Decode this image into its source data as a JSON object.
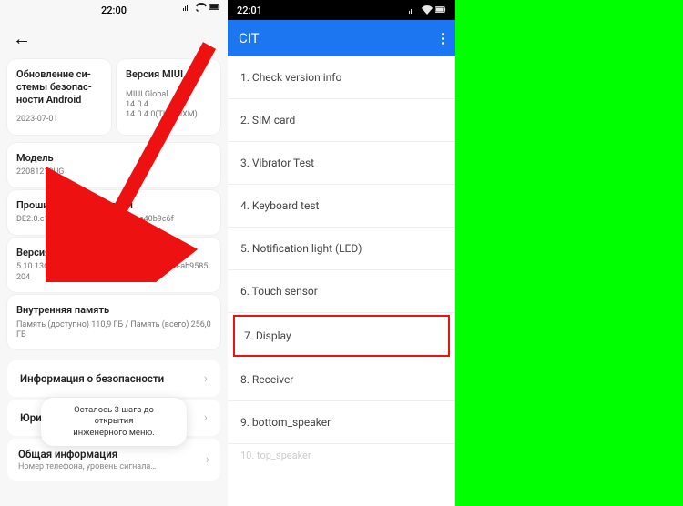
{
  "left": {
    "status_time": "22:00",
    "card1_title": "Обновление си-\nстемы безопас-\nности Android",
    "card1_sub": "2023-07-01",
    "card2_title": "Версия MIUI",
    "card2_sub": "MIUI Global\n14.0.4\n14.0.4.0(TLFRUXM)",
    "model_title": "Модель",
    "model_sub": "22081212UG",
    "firmware_title": "Прошивка модуля связи",
    "firmware_sub": "DE2.0.c1-gl-19921.1…6_0554_b5ce40b9c6f",
    "kernel_title": "Версия ядра",
    "kernel_sub": "5.10.136-android12-9-00021-g821df8f5bd36-ab9585204",
    "storage_title": "Внутренняя память",
    "storage_sub": "Память (доступно)  110,9 ГБ / Память (всего)  256,0 ГБ",
    "security_info": "Информация о безопасности",
    "legal_prefix": "Юри",
    "toast_line1": "Осталось 3 шага до открытия",
    "toast_line2": "инженерного меню.",
    "general_title": "Общая информация",
    "general_sub": "Номер телефона, уровень сигнала…",
    "chevron": "›"
  },
  "mid": {
    "status_time": "22:01",
    "title": "CIT",
    "items": [
      "1. Check version info",
      "2. SIM card",
      "3. Vibrator Test",
      "4. Keyboard test",
      "5. Notification light (LED)",
      "6. Touch sensor",
      "7. Display",
      "8. Receiver",
      "9. bottom_speaker"
    ],
    "partial_item": "10. top_speaker"
  }
}
